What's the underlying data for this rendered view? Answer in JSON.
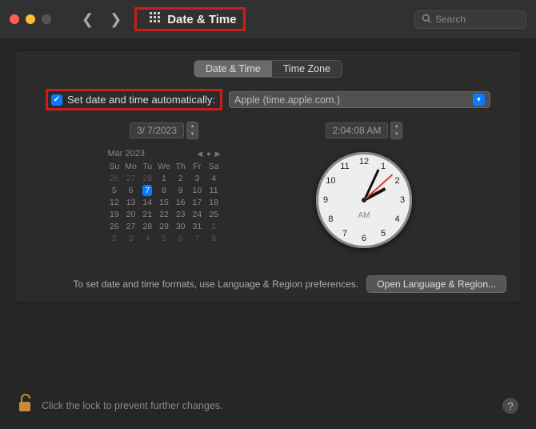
{
  "titlebar": {
    "title": "Date & Time",
    "search_placeholder": "Search"
  },
  "tabs": {
    "date_time": "Date & Time",
    "time_zone": "Time Zone"
  },
  "auto": {
    "label": "Set date and time automatically:",
    "server": "Apple (time.apple.com.)"
  },
  "date": {
    "field": "3/  7/2023",
    "month_label": "Mar 2023",
    "dow": [
      "Su",
      "Mo",
      "Tu",
      "We",
      "Th",
      "Fr",
      "Sa"
    ],
    "weeks": [
      [
        {
          "d": "26",
          "dim": true
        },
        {
          "d": "27",
          "dim": true
        },
        {
          "d": "28",
          "dim": true
        },
        {
          "d": "1"
        },
        {
          "d": "2"
        },
        {
          "d": "3"
        },
        {
          "d": "4"
        }
      ],
      [
        {
          "d": "5"
        },
        {
          "d": "6"
        },
        {
          "d": "7",
          "today": true
        },
        {
          "d": "8"
        },
        {
          "d": "9"
        },
        {
          "d": "10"
        },
        {
          "d": "11"
        }
      ],
      [
        {
          "d": "12"
        },
        {
          "d": "13"
        },
        {
          "d": "14"
        },
        {
          "d": "15"
        },
        {
          "d": "16"
        },
        {
          "d": "17"
        },
        {
          "d": "18"
        }
      ],
      [
        {
          "d": "19"
        },
        {
          "d": "20"
        },
        {
          "d": "21"
        },
        {
          "d": "22"
        },
        {
          "d": "23"
        },
        {
          "d": "24"
        },
        {
          "d": "25"
        }
      ],
      [
        {
          "d": "26"
        },
        {
          "d": "27"
        },
        {
          "d": "28"
        },
        {
          "d": "29"
        },
        {
          "d": "30"
        },
        {
          "d": "31"
        },
        {
          "d": "1",
          "dim": true
        }
      ],
      [
        {
          "d": "2",
          "dim": true
        },
        {
          "d": "3",
          "dim": true
        },
        {
          "d": "4",
          "dim": true
        },
        {
          "d": "5",
          "dim": true
        },
        {
          "d": "6",
          "dim": true
        },
        {
          "d": "7",
          "dim": true
        },
        {
          "d": "8",
          "dim": true
        }
      ]
    ]
  },
  "time": {
    "field": "2:04:08 AM",
    "ampm": "AM",
    "hour12": 2,
    "minute": 4,
    "second": 8,
    "numerals": [
      "12",
      "1",
      "2",
      "3",
      "4",
      "5",
      "6",
      "7",
      "8",
      "9",
      "10",
      "11"
    ]
  },
  "footer": {
    "hint": "To set date and time formats, use Language & Region preferences.",
    "button": "Open Language & Region..."
  },
  "lock": {
    "text": "Click the lock to prevent further changes."
  }
}
